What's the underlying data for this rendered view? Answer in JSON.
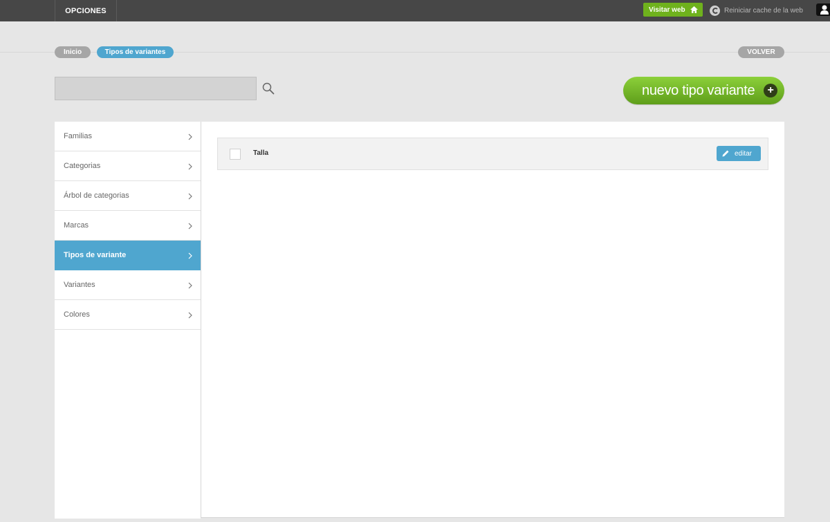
{
  "topbar": {
    "menu_label": "OPCIONES",
    "visit_label": "Visitar web",
    "reset_label": "Reiniciar cache de la web"
  },
  "breadcrumb": {
    "items": [
      "Inicio",
      "Tipos de variantes"
    ],
    "back_label": "VOLVER"
  },
  "search": {
    "value": "",
    "placeholder": ""
  },
  "new_button": {
    "label": "nuevo tipo variante"
  },
  "sidebar": {
    "items": [
      {
        "label": "Familias"
      },
      {
        "label": "Categorias"
      },
      {
        "label": "Árbol de categorias"
      },
      {
        "label": "Marcas"
      },
      {
        "label": "Tipos de variante",
        "active": true
      },
      {
        "label": "Variantes"
      },
      {
        "label": "Colores"
      }
    ]
  },
  "list": {
    "rows": [
      {
        "name": "Talla",
        "edit_label": "editar"
      }
    ]
  },
  "colors": {
    "topbar": "#474747",
    "accent_blue": "#4fa6cf",
    "accent_green": "#6fb21d",
    "pill_gray": "#a6a6a6"
  },
  "icons": [
    "home-icon",
    "refresh-icon",
    "user-icon",
    "search-icon",
    "plus-icon",
    "chevron-right-icon",
    "pencil-icon"
  ]
}
